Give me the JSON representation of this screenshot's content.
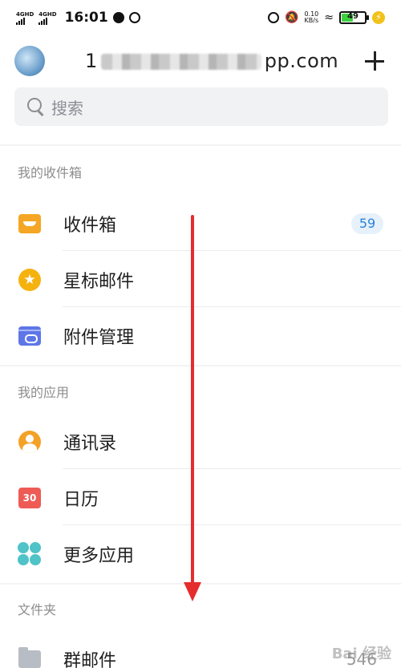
{
  "status_bar": {
    "net1": "4GHD",
    "net2": "4GHD",
    "time": "16:01",
    "speed_value": "0.10",
    "speed_unit": "KB/s",
    "battery": "49",
    "battery_level": 0.49
  },
  "header": {
    "account_prefix": "1",
    "account_suffix": "pp.com"
  },
  "search": {
    "placeholder": "搜索"
  },
  "sections": {
    "my_inbox": "我的收件箱",
    "my_apps": "我的应用",
    "folders": "文件夹"
  },
  "items": {
    "inbox": {
      "label": "收件箱",
      "badge": "59"
    },
    "starred": {
      "label": "星标邮件"
    },
    "attachments": {
      "label": "附件管理"
    },
    "contacts": {
      "label": "通讯录"
    },
    "calendar": {
      "label": "日历",
      "icon_text": "30"
    },
    "more_apps": {
      "label": "更多应用"
    },
    "group_mail": {
      "label": "群邮件",
      "count": "546"
    }
  },
  "watermark": "Bai 经验",
  "colors": {
    "arrow": "#e52d2d",
    "badge_text": "#2b82d9"
  }
}
